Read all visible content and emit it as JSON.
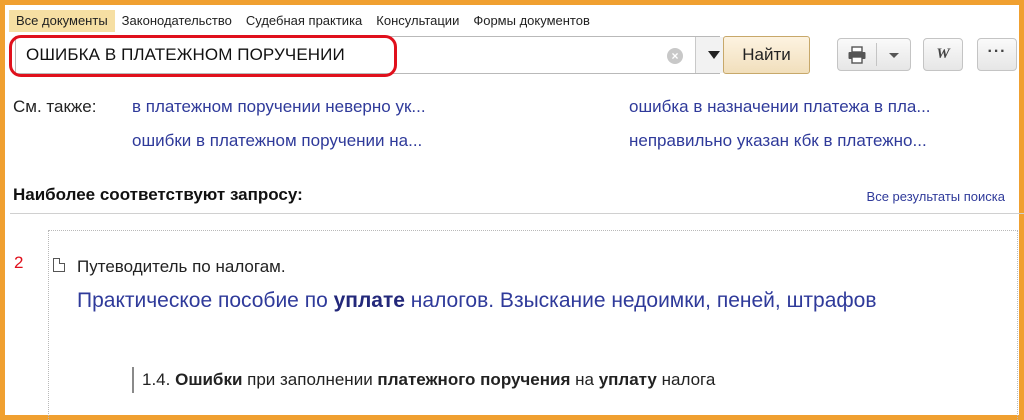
{
  "tabs": [
    {
      "label": "Все документы",
      "active": true
    },
    {
      "label": "Законодательство",
      "active": false
    },
    {
      "label": "Судебная практика",
      "active": false
    },
    {
      "label": "Консультации",
      "active": false
    },
    {
      "label": "Формы документов",
      "active": false
    }
  ],
  "search": {
    "query": "ОШИБКА В ПЛАТЕЖНОМ ПОРУЧЕНИИ",
    "find_label": "Найти",
    "clear_glyph": "×"
  },
  "toolbar": {
    "print_icon": "printer-icon",
    "word_label": "W",
    "more_label": "···"
  },
  "see_also": {
    "label": "См. также:",
    "links": [
      "в платежном поручении неверно ук...",
      "ошибки в платежном поручении на...",
      "ошибка в назначении платежа в пла...",
      "неправильно указан кбк в платежно..."
    ]
  },
  "results_header": {
    "title": "Наиболее соответствуют запросу:",
    "all_results": "Все результаты поиска"
  },
  "result": {
    "number": "2",
    "source": "Путеводитель по налогам.",
    "title_parts": [
      {
        "text": "Практическое пособие по ",
        "bold": false
      },
      {
        "text": "уплате",
        "bold": true
      },
      {
        "text": " налогов. Взыскание недоимки, пеней, штрафов",
        "bold": false
      }
    ],
    "snippet_parts": [
      {
        "text": "1.4. ",
        "bold": false
      },
      {
        "text": "Ошибки",
        "bold": true
      },
      {
        "text": " при заполнении ",
        "bold": false
      },
      {
        "text": "платежного поручения",
        "bold": true
      },
      {
        "text": " на ",
        "bold": false
      },
      {
        "text": "уплату",
        "bold": true
      },
      {
        "text": " налога",
        "bold": false
      }
    ]
  },
  "colors": {
    "accent_border": "#f0a030",
    "active_tab": "#f6dfa3",
    "link": "#2f3a9a",
    "highlight": "#e0101c"
  }
}
